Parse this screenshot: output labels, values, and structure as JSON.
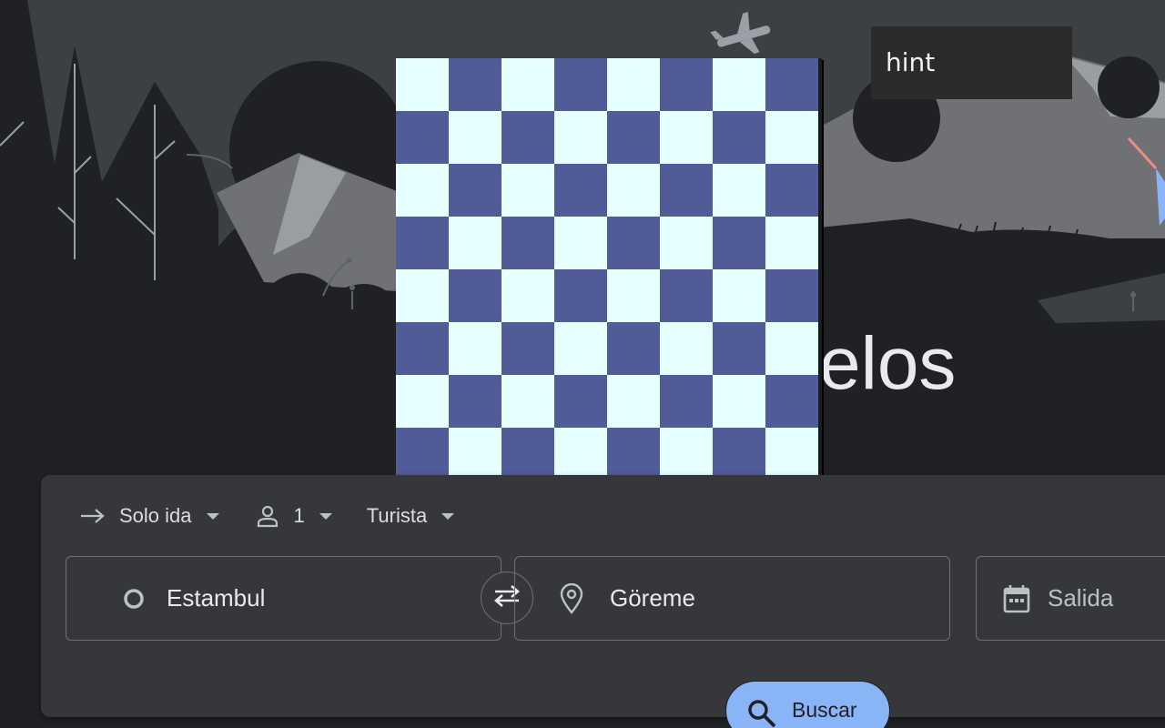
{
  "hero": {
    "title_fragment": "elos"
  },
  "popup": {
    "hint_text": "hint",
    "grid_size": 8,
    "light_color": "#e6ffff",
    "dark_color": "#515b98"
  },
  "search": {
    "trip_type": {
      "label": "Solo ida",
      "icon": "arrow-right-icon"
    },
    "passengers": {
      "label": "1",
      "icon": "person-icon"
    },
    "cabin_class": {
      "label": "Turista"
    },
    "origin": {
      "value": "Estambul",
      "icon": "circle-outline-icon"
    },
    "swap": {
      "icon": "swap-arrows-icon"
    },
    "destination": {
      "value": "Göreme",
      "icon": "location-pin-icon"
    },
    "departure": {
      "placeholder": "Salida",
      "icon": "calendar-icon"
    },
    "submit": {
      "label": "Buscar",
      "icon": "search-icon"
    }
  },
  "colors": {
    "background": "#202124",
    "card": "#36373b",
    "accent": "#8ab4f8",
    "text": "#e8eaed"
  }
}
